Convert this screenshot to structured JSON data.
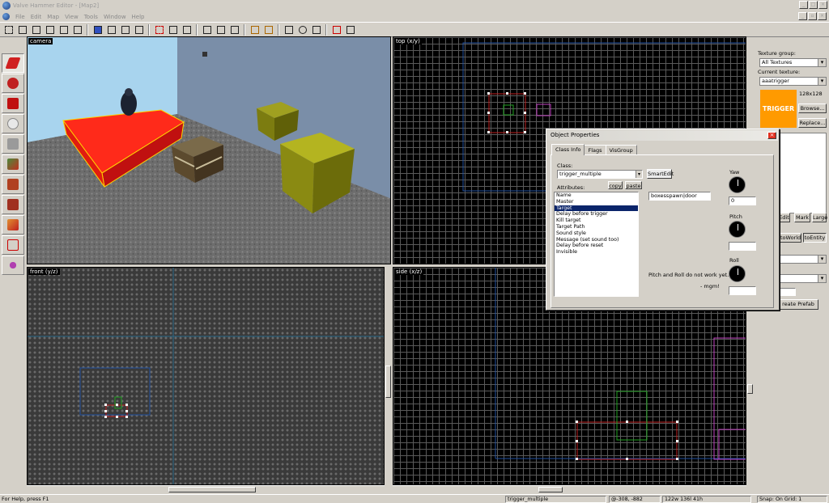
{
  "window": {
    "title": "Valve Hammer Editor - [Map2]"
  },
  "menu": [
    "File",
    "Edit",
    "Map",
    "View",
    "Tools",
    "Window",
    "Help"
  ],
  "views": {
    "camera": "camera",
    "top": "top (x/y)",
    "front": "front (y/z)",
    "side": "side (x/z)"
  },
  "right_panel": {
    "texture_group_label": "Texture group:",
    "texture_group_value": "All Textures",
    "current_texture_label": "Current texture:",
    "current_texture_value": "aaatrigger",
    "texture_preview_text": "TRIGGER",
    "texture_size": "128x128",
    "browse": "Browse...",
    "replace": "Replace...",
    "edit": "Edit",
    "mark": "Mark",
    "large": "Large",
    "to_world": "toWorld",
    "to_entity": "toEntity",
    "create_prefab": "reate Prefab"
  },
  "dialog": {
    "title": "Object Properties",
    "tabs": [
      "Class Info",
      "Flags",
      "VisGroup"
    ],
    "class_label": "Class:",
    "class_value": "trigger_multiple",
    "smartedit_label": "SmartEdit",
    "attributes_label": "Attributes:",
    "copy": "copy",
    "paste": "paste",
    "attributes": [
      "Name",
      "Master",
      "Target",
      "Delay before trigger",
      "Kill target",
      "Target Path",
      "Sound style",
      "Message (set sound too)",
      "Delay before reset",
      "Invisible"
    ],
    "selected_attribute": 2,
    "value_field": "boxesspawn|door",
    "yaw_label": "Yaw",
    "yaw_value": "0",
    "pitch_label": "Pitch",
    "pitch_value": "",
    "roll_label": "Roll",
    "roll_value": "",
    "pitch_note": "Pitch and Roll do not work yet. ->",
    "pitch_note2": "- mgm!"
  },
  "statusbar": {
    "help": "For Help, press F1",
    "selection": "trigger_multiple",
    "coords": "@-308, -882",
    "size": "122w 136l 41h",
    "snap": "Snap: On Grid: 1"
  }
}
